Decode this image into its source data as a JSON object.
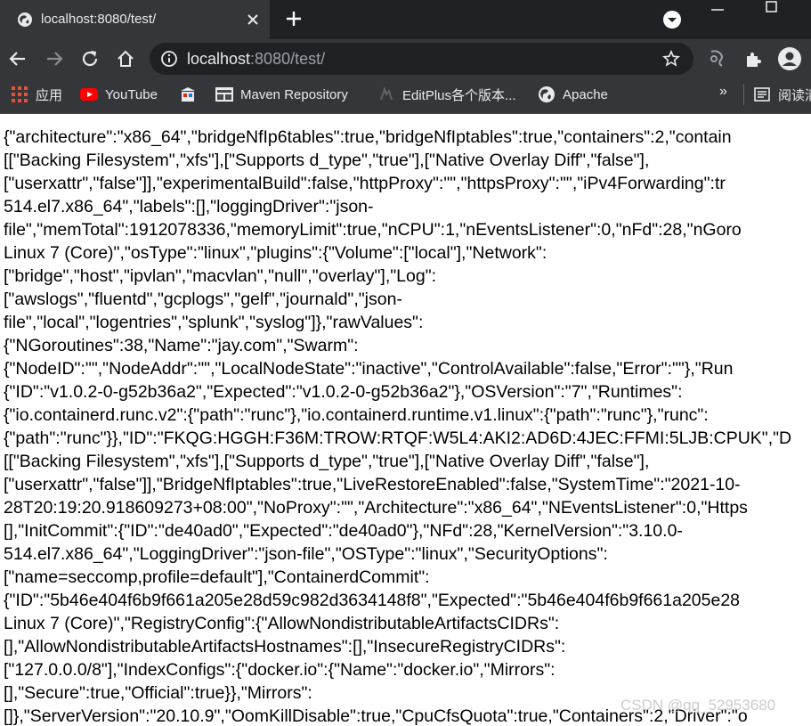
{
  "browser": {
    "tab": {
      "title": "localhost:8080/test/"
    },
    "address_bar": {
      "host": "localhost",
      "rest": ":8080/test/"
    },
    "bookmarks": [
      {
        "label": "应用",
        "icon": "apps-grid-icon"
      },
      {
        "label": "YouTube",
        "icon": "youtube-icon"
      },
      {
        "label": "",
        "icon": "bookmark-shop-icon"
      },
      {
        "label": "Maven Repository",
        "icon": "maven-icon"
      },
      {
        "label": "EditPlus各个版本...",
        "icon": "editplus-icon"
      },
      {
        "label": "Apache",
        "icon": "globe-icon"
      }
    ],
    "bookmarks_overflow": "»",
    "reading_list_label": "阅读清"
  },
  "page": {
    "lines": [
      "{\"architecture\":\"x86_64\",\"bridgeNfIp6tables\":true,\"bridgeNfIptables\":true,\"containers\":2,\"contain",
      "[[\"Backing Filesystem\",\"xfs\"],[\"Supports d_type\",\"true\"],[\"Native Overlay Diff\",\"false\"],",
      "[\"userxattr\",\"false\"]],\"experimentalBuild\":false,\"httpProxy\":\"\",\"httpsProxy\":\"\",\"iPv4Forwarding\":tr",
      "514.el7.x86_64\",\"labels\":[],\"loggingDriver\":\"json-",
      "file\",\"memTotal\":1912078336,\"memoryLimit\":true,\"nCPU\":1,\"nEventsListener\":0,\"nFd\":28,\"nGoro",
      "Linux 7 (Core)\",\"osType\":\"linux\",\"plugins\":{\"Volume\":[\"local\"],\"Network\":",
      "[\"bridge\",\"host\",\"ipvlan\",\"macvlan\",\"null\",\"overlay\"],\"Log\":",
      "[\"awslogs\",\"fluentd\",\"gcplogs\",\"gelf\",\"journald\",\"json-",
      "file\",\"local\",\"logentries\",\"splunk\",\"syslog\"]},\"rawValues\":",
      "{\"NGoroutines\":38,\"Name\":\"jay.com\",\"Swarm\":",
      "{\"NodeID\":\"\",\"NodeAddr\":\"\",\"LocalNodeState\":\"inactive\",\"ControlAvailable\":false,\"Error\":\"\"},\"Run",
      "{\"ID\":\"v1.0.2-0-g52b36a2\",\"Expected\":\"v1.0.2-0-g52b36a2\"},\"OSVersion\":\"7\",\"Runtimes\":",
      "{\"io.containerd.runc.v2\":{\"path\":\"runc\"},\"io.containerd.runtime.v1.linux\":{\"path\":\"runc\"},\"runc\":",
      "{\"path\":\"runc\"}},\"ID\":\"FKQG:HGGH:F36M:TROW:RTQF:W5L4:AKI2:AD6D:4JEC:FFMI:5LJB:CPUK\",\"D",
      "[[\"Backing Filesystem\",\"xfs\"],[\"Supports d_type\",\"true\"],[\"Native Overlay Diff\",\"false\"],",
      "[\"userxattr\",\"false\"]],\"BridgeNfIptables\":true,\"LiveRestoreEnabled\":false,\"SystemTime\":\"2021-10-",
      "28T20:19:20.918609273+08:00\",\"NoProxy\":\"\",\"Architecture\":\"x86_64\",\"NEventsListener\":0,\"Https",
      "[],\"InitCommit\":{\"ID\":\"de40ad0\",\"Expected\":\"de40ad0\"},\"NFd\":28,\"KernelVersion\":\"3.10.0-",
      "514.el7.x86_64\",\"LoggingDriver\":\"json-file\",\"OSType\":\"linux\",\"SecurityOptions\":",
      "[\"name=seccomp,profile=default\"],\"ContainerdCommit\":",
      "{\"ID\":\"5b46e404f6b9f661a205e28d59c982d3634148f8\",\"Expected\":\"5b46e404f6b9f661a205e28",
      "Linux 7 (Core)\",\"RegistryConfig\":{\"AllowNondistributableArtifactsCIDRs\":",
      "[],\"AllowNondistributableArtifactsHostnames\":[],\"InsecureRegistryCIDRs\":",
      "[\"127.0.0.0/8\"],\"IndexConfigs\":{\"docker.io\":{\"Name\":\"docker.io\",\"Mirrors\":",
      "[],\"Secure\":true,\"Official\":true}},\"Mirrors\":",
      "[]},\"ServerVersion\":\"20.10.9\",\"OomKillDisable\":true,\"CpuCfsQuota\":true,\"Containers\":2,\"Driver\":\"o"
    ],
    "watermark": "CSDN @qq_52953680"
  }
}
